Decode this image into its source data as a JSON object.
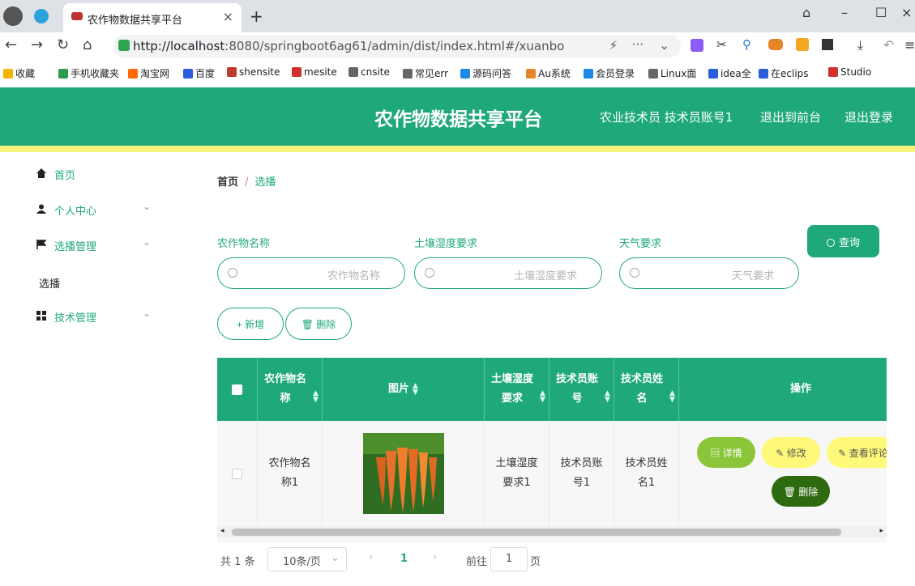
{
  "browser": {
    "tab_title": "农作物数据共享平台",
    "url_host": "http://localhost",
    "url_rest": ":8080/springboot6ag61/admin/dist/index.html#/xuanbo",
    "bookmarks": [
      "收藏",
      "手机收藏夹",
      "淘宝网",
      "百度",
      "shensite",
      "mesite",
      "cnsite",
      "常见err",
      "源码问答",
      "Au系统",
      "会员登录",
      "Linux面",
      "idea全",
      "在eclips",
      "Studio"
    ]
  },
  "header": {
    "title": "农作物数据共享平台",
    "user": "农业技术员 技术员账号1",
    "to_front": "退出到前台",
    "logout": "退出登录"
  },
  "sidebar": {
    "items": [
      {
        "label": "首页",
        "icon": "home-icon"
      },
      {
        "label": "个人中心",
        "icon": "user-icon"
      },
      {
        "label": "选播管理",
        "icon": "flag-icon"
      },
      {
        "label": "技术管理",
        "icon": "grid-icon"
      }
    ],
    "sub_label": "选播"
  },
  "breadcrumb": {
    "home": "首页",
    "sep": "/",
    "current": "选播"
  },
  "filters": [
    {
      "label": "农作物名称",
      "placeholder": "农作物名称"
    },
    {
      "label": "土壤湿度要求",
      "placeholder": "土壤湿度要求"
    },
    {
      "label": "天气要求",
      "placeholder": "天气要求"
    }
  ],
  "buttons": {
    "query": "查询",
    "add": "新增",
    "delete": "删除"
  },
  "table": {
    "headers": [
      "农作物名称",
      "图片",
      "土壤湿度要求",
      "技术员账号",
      "技术员姓名",
      "操作"
    ],
    "rows": [
      {
        "crop": "农作物名称1",
        "soil": "土壤湿度要求1",
        "account": "技术员账号1",
        "name": "技术员姓名1"
      }
    ],
    "row_actions": {
      "detail": "详情",
      "edit": "修改",
      "comments": "查看评论",
      "delete": "删除"
    }
  },
  "pager": {
    "total": "共 1 条",
    "page_size": "10条/页",
    "current_page": "1",
    "goto_label": "前往",
    "goto_value": "1",
    "page_unit": "页"
  },
  "colors": {
    "primary": "#1fa97b",
    "yellow_band": "#f7f27a",
    "detail_bg": "#8ac53a",
    "edit_bg": "#fff97a",
    "delete_bg": "#2e6b10"
  }
}
